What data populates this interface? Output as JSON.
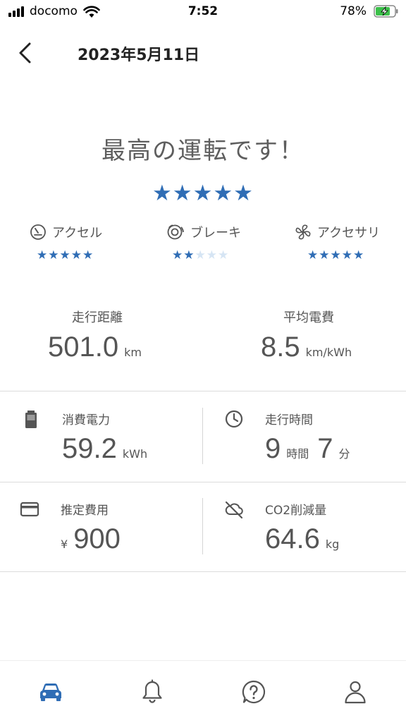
{
  "status_bar": {
    "carrier": "docomo",
    "time": "7:52",
    "battery": "78%"
  },
  "header": {
    "title": "2023年5月11日"
  },
  "summary": {
    "headline": "最高の運転です！",
    "stars": "★★★★★"
  },
  "categories": [
    {
      "label": "アクセル",
      "rating": 5,
      "icon": "gauge-icon"
    },
    {
      "label": "ブレーキ",
      "rating": 2,
      "icon": "brake-icon"
    },
    {
      "label": "アクセサリ",
      "rating": 5,
      "icon": "fan-icon"
    }
  ],
  "stats": {
    "distance": {
      "label": "走行距離",
      "value": "501.0",
      "unit": "km"
    },
    "efficiency": {
      "label": "平均電費",
      "value": "8.5",
      "unit": "km/kWh"
    }
  },
  "details": {
    "power": {
      "label": "消費電力",
      "value": "59.2",
      "unit": "kWh",
      "icon": "battery-icon"
    },
    "time": {
      "label": "走行時間",
      "hours": "9",
      "hours_unit": "時間",
      "minutes": "7",
      "minutes_unit": "分",
      "icon": "clock-icon"
    },
    "cost": {
      "label": "推定費用",
      "currency": "¥",
      "value": "900",
      "icon": "card-icon"
    },
    "co2": {
      "label": "CO2削減量",
      "value": "64.6",
      "unit": "kg",
      "icon": "cloud-off-icon"
    }
  },
  "bottom_nav": [
    {
      "name": "car",
      "icon": "car-icon",
      "active": true
    },
    {
      "name": "notifications",
      "icon": "bell-icon",
      "active": false
    },
    {
      "name": "help",
      "icon": "help-icon",
      "active": false
    },
    {
      "name": "profile",
      "icon": "person-icon",
      "active": false
    }
  ],
  "colors": {
    "accent": "#2f6db5",
    "star_off": "#d6e5f4",
    "text": "#555555"
  }
}
